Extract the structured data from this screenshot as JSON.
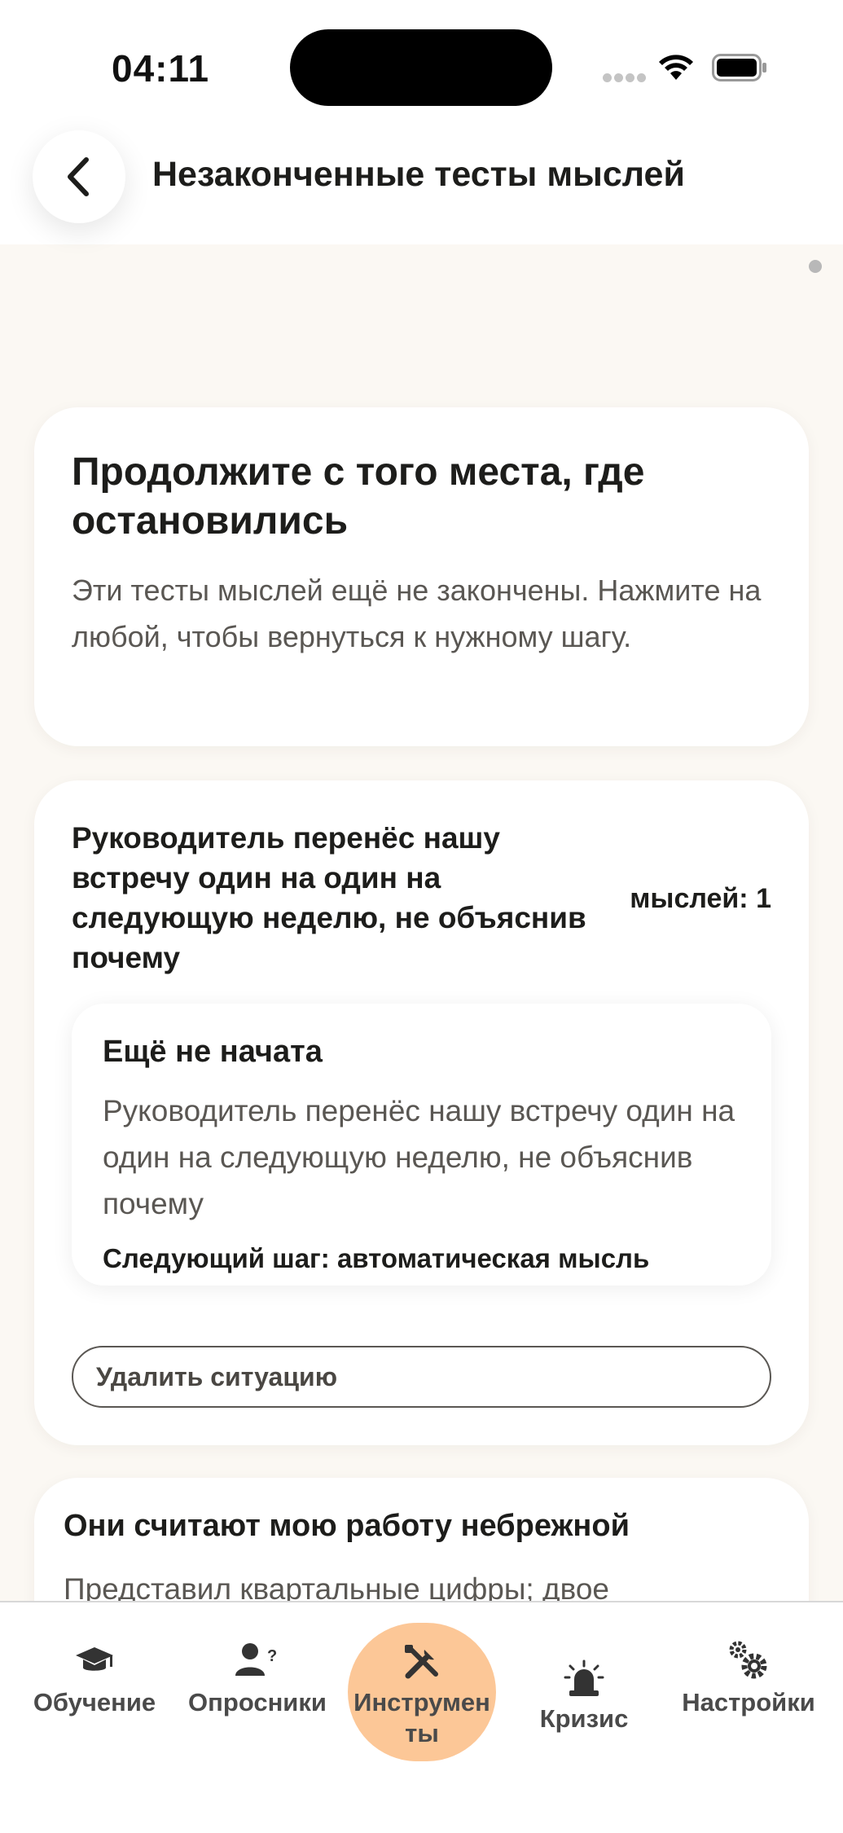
{
  "status_bar": {
    "time": "04:11"
  },
  "header": {
    "title": "Незаконченные тесты мыслей"
  },
  "intro": {
    "title": "Продолжите с того места, где остановились",
    "text": "Эти тесты мыслей ещё не закончены. Нажмите на любой, чтобы вернуться к нужному шагу."
  },
  "situations": [
    {
      "title": "Руководитель перенёс нашу встречу один на один на следующую неделю, не объяснив почему",
      "count": "мыслей: 1",
      "thought": {
        "status": "Ещё не начата",
        "text": "Руководитель перенёс нашу встречу один на один на следующую неделю, не объяснив почему",
        "next_step": "Следующий шаг: автоматическая мысль"
      },
      "delete_label": "Удалить ситуацию"
    },
    {
      "title": "Они считают мою работу небрежной",
      "preview": "Представил квартальные цифры; двое"
    }
  ],
  "tabs": [
    {
      "label": "Обучение",
      "icon": "graduation-cap-icon",
      "active": false
    },
    {
      "label": "Опросники",
      "icon": "user-question-icon",
      "active": false
    },
    {
      "label": "Инструменты",
      "icon": "tools-icon",
      "active": true
    },
    {
      "label": "Кризис",
      "icon": "siren-icon",
      "active": false
    },
    {
      "label": "Настройки",
      "icon": "gears-icon",
      "active": false
    }
  ],
  "colors": {
    "background": "#fbf8f3",
    "card": "#ffffff",
    "accent_tab": "#fcc797",
    "text_primary": "#1d1d1b",
    "text_secondary": "#5a5753"
  }
}
